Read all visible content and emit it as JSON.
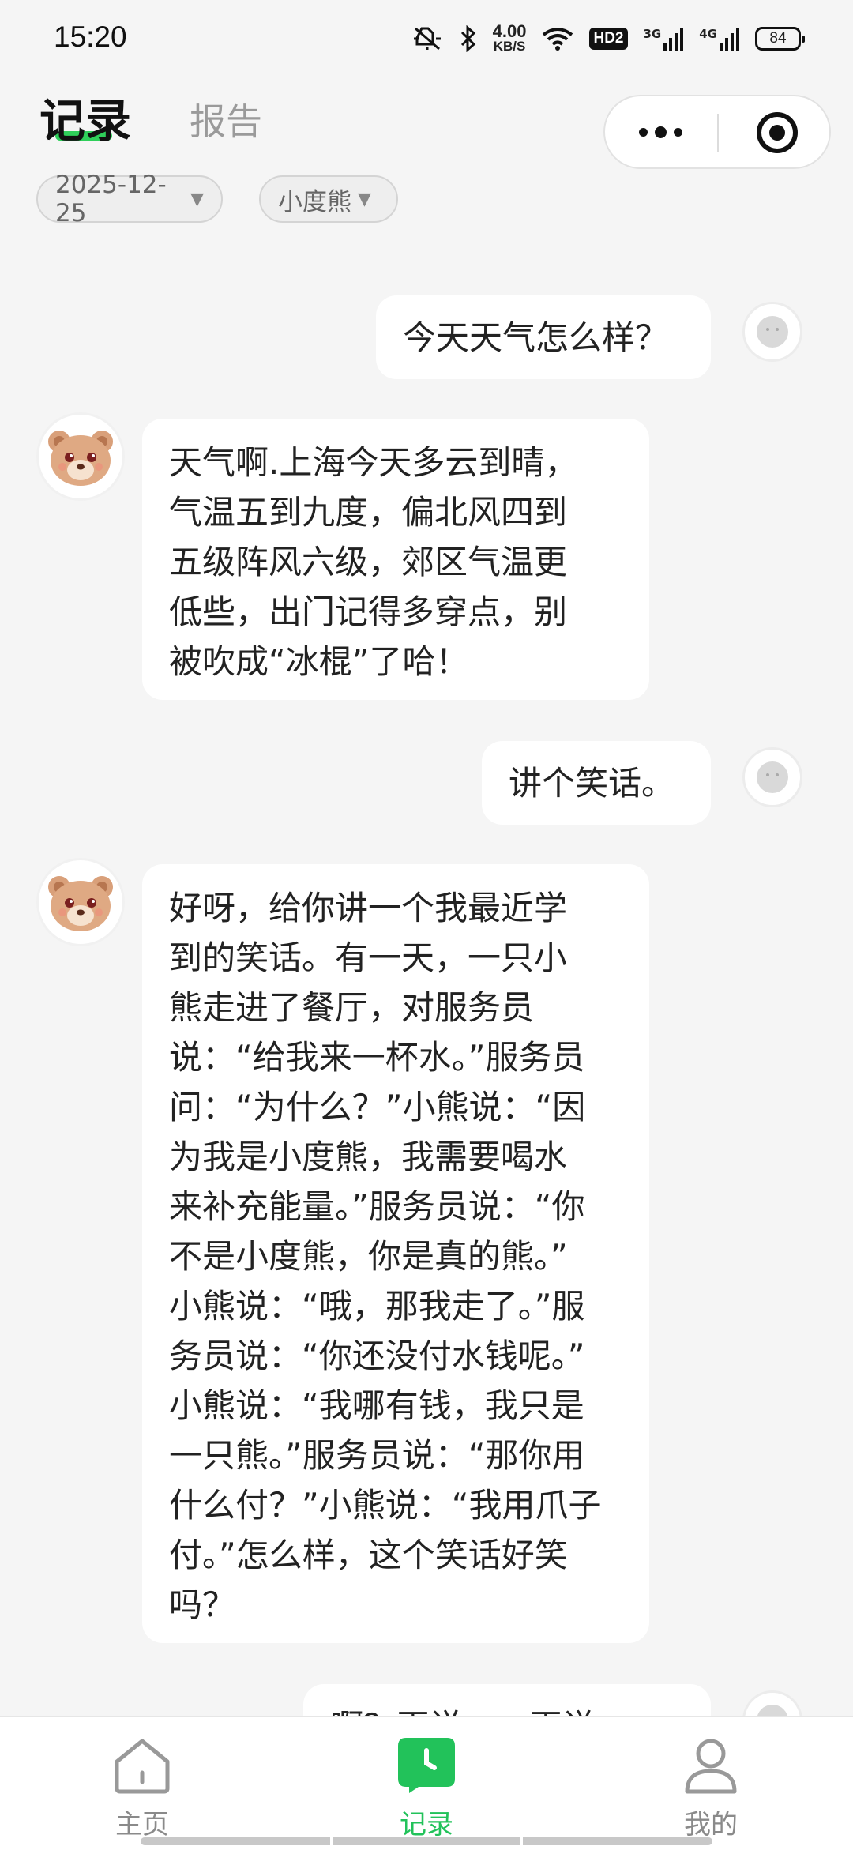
{
  "status_bar": {
    "time": "15:20",
    "net_speed_value": "4.00",
    "net_speed_unit": "KB/S",
    "hd_label": "HD2",
    "signal1_label": "3G",
    "signal2_label": "4G",
    "battery": "84",
    "icons": [
      "mute-icon",
      "bluetooth-icon",
      "wifi-icon",
      "signal-icon",
      "battery-icon"
    ]
  },
  "header": {
    "tab_active": "记录",
    "tab_inactive": "报告",
    "accent": "#2fcf5a"
  },
  "filters": {
    "date": "2025-12-25",
    "device": "小度熊"
  },
  "messages": [
    {
      "role": "user",
      "text": "今天天气怎么样？"
    },
    {
      "role": "bot",
      "lines": [
        "天气啊.上海今天多云到晴，",
        "气温五到九度，偏北风四到",
        "五级阵风六级，郊区气温更",
        "低些，出门记得多穿点，别",
        "被吹成“冰棍”了哈！"
      ]
    },
    {
      "role": "user",
      "text": "讲个笑话。"
    },
    {
      "role": "bot",
      "lines": [
        "好呀，给你讲一个我最近学",
        "到的笑话。有一天，一只小",
        "熊走进了餐厅，对服务员",
        "说：“给我来一杯水。”服务员",
        "问：“为什么？”小熊说：“因",
        "为我是小度熊，我需要喝水",
        "来补充能量。”服务员说：“你",
        "不是小度熊，你是真的熊。”",
        "小熊说：“哦，那我走了。”服",
        "务员说：“你还没付水钱呢。”",
        "小熊说：“我哪有钱，我只是",
        "一只熊。”服务员说：“那你用",
        "什么付？”小熊说：“我用爪子",
        "付。”怎么样，这个笑话好笑",
        "吗？"
      ]
    },
    {
      "role": "user",
      "text": "啊？再说一，再说一"
    }
  ],
  "nav": {
    "home": "主页",
    "record": "记录",
    "mine": "我的",
    "active_color": "#22c25a"
  }
}
